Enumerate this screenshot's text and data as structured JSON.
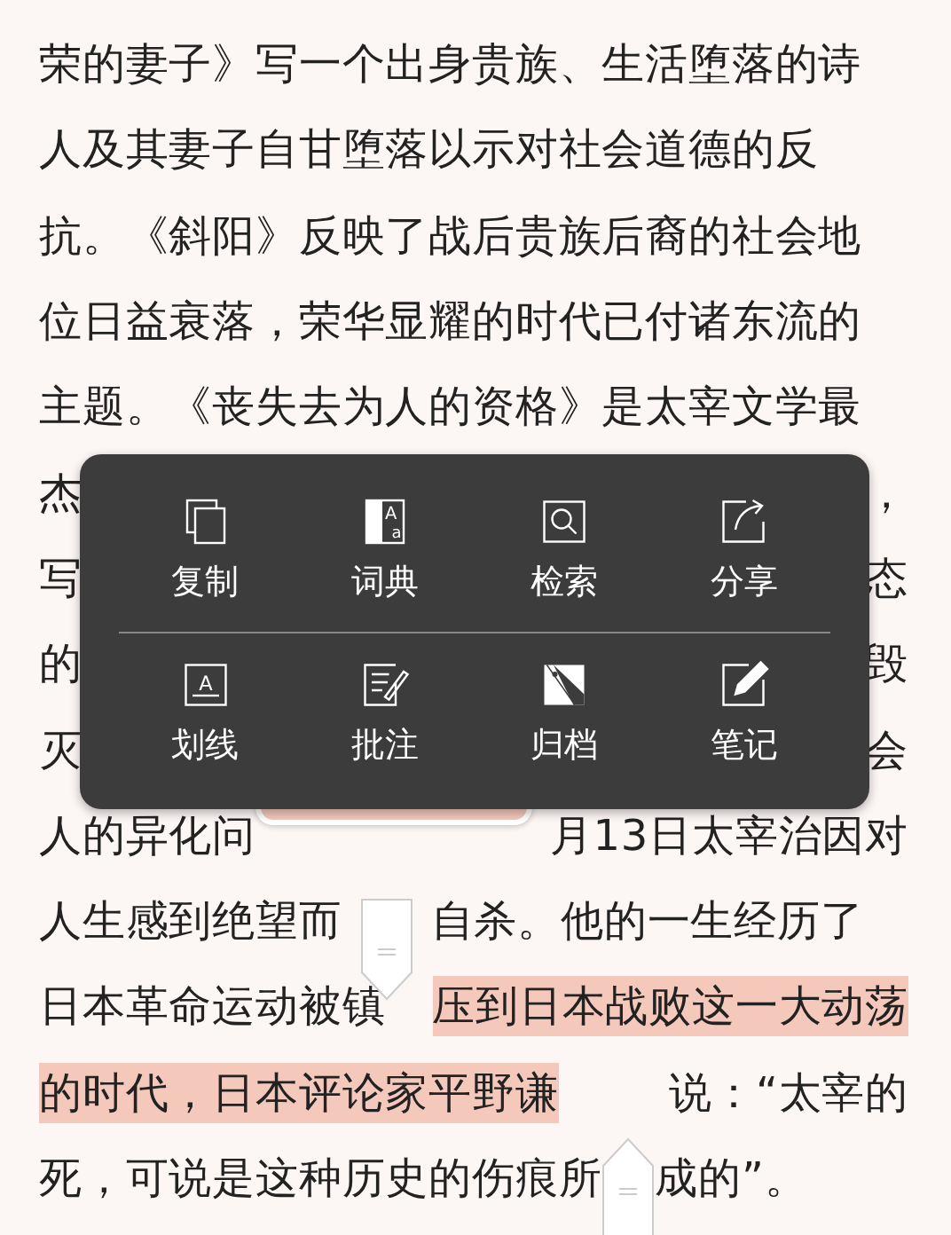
{
  "lines": [
    {
      "segments": [
        {
          "kind": "text",
          "text": "荣的妻子》写一个出身贵族、生活堕落的诗"
        }
      ]
    },
    {
      "segments": [
        {
          "kind": "text",
          "text": "人及其妻子自甘堕落以示对社会道德的反"
        }
      ]
    },
    {
      "segments": [
        {
          "kind": "text",
          "text": "抗。《斜阳》反映了战后贵族后裔的社会地"
        }
      ]
    },
    {
      "segments": [
        {
          "kind": "text",
          "text": "位日益衰落，荣华显耀的时代已付诸东流的"
        }
      ]
    },
    {
      "segments": [
        {
          "kind": "text",
          "text": "主题。《丧失去为人的资格》是太宰文学最"
        }
      ]
    },
    {
      "segments": [
        {
          "kind": "text",
          "text": "杰"
        },
        {
          "kind": "text",
          "text": "，"
        }
      ]
    },
    {
      "segments": [
        {
          "kind": "text",
          "text": "写"
        },
        {
          "kind": "text",
          "text": "态"
        }
      ]
    },
    {
      "segments": [
        {
          "kind": "text",
          "text": "的"
        },
        {
          "kind": "text",
          "text": "毁"
        }
      ]
    },
    {
      "segments": [
        {
          "kind": "text",
          "text": "灭"
        },
        {
          "kind": "text",
          "text": "会"
        }
      ]
    },
    {
      "segments": [
        {
          "kind": "text",
          "text": "人的异化问"
        },
        {
          "kind": "loupe"
        },
        {
          "kind": "text",
          "text": "月13日太宰治因对"
        }
      ]
    },
    {
      "segments": [
        {
          "kind": "text",
          "text": "人生感到绝望而"
        },
        {
          "kind": "start-handle"
        },
        {
          "kind": "text",
          "text": "自杀。他的一生经历了"
        }
      ]
    },
    {
      "segments": [
        {
          "kind": "text",
          "text": "日本革命运动被镇"
        },
        {
          "kind": "highlight",
          "text": "压到日本战败这一大动荡"
        }
      ]
    },
    {
      "segments": [
        {
          "kind": "highlight",
          "text": "的时代，日本评论家平野谦"
        },
        {
          "kind": "text",
          "text": "说：“太宰的"
        }
      ]
    },
    {
      "segments": [
        {
          "kind": "text",
          "text": "死，可说是这种历史的伤痕所"
        },
        {
          "kind": "end-handle"
        },
        {
          "kind": "text",
          "text": "成的”。"
        }
      ]
    }
  ],
  "menu": {
    "rows": [
      [
        {
          "label": "复制"
        },
        {
          "label": "词典",
          "icon_letters": [
            "A",
            "a"
          ]
        },
        {
          "label": "检索"
        },
        {
          "label": "分享"
        }
      ],
      [
        {
          "label": "划线",
          "icon_letters": [
            "A"
          ]
        },
        {
          "label": "批注"
        },
        {
          "label": "归档"
        },
        {
          "label": "笔记"
        }
      ]
    ]
  }
}
